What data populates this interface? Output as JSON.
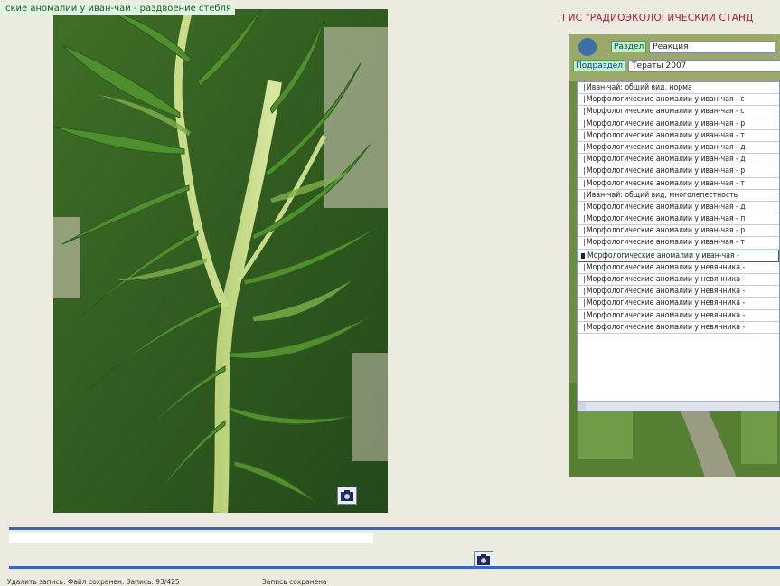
{
  "photo": {
    "caption": "ские аномалии у иван-чай - раздвоение стебля"
  },
  "gis": {
    "title": "ГИС \"РАДИОЭКОЛОГИЧЕСКИЙ СТАНД",
    "section_label": "Раздел",
    "section_value": "Реакция",
    "subsection_label": "Подраздел",
    "subsection_value": "Тераты 2007",
    "items": [
      "Иван-чай: общий вид, норма",
      "Морфологические аномалии у иван-чая - с",
      "Морфологические аномалии у иван-чая - с",
      "Морфологические аномалии у иван-чая - р",
      "Морфологические аномалии у иван-чая - т",
      "Морфологические аномалии у иван-чая - д",
      "Морфологические аномалии у иван-чая - д",
      "Морфологические аномалии у иван-чая - р",
      "Морфологические аномалии у иван-чая - т",
      "Иван-чай: общий вид, многолепестность",
      "Морфологические аномалии у иван-чая - д",
      "Морфологические аномалии у иван-чая - п",
      "Морфологические аномалии у иван-чая - р",
      "Морфологические аномалии у иван-чая - т",
      "Морфологические аномалии у иван-чая -",
      "Морфологические аномалии у невянника -",
      "Морфологические аномалии у невянника -",
      "Морфологические аномалии у невянника -",
      "Морфологические аномалии у невянника -",
      "Морфологические аномалии у невянника -",
      "Морфологические аномалии у невянника -"
    ],
    "selected_index": 14,
    "accent_title": "#a01c3a"
  },
  "status": {
    "left": "Удалить запись. Файл сохранен. Запись: 93/425",
    "right": "Запись сохранена"
  },
  "colors": {
    "rule": "#3b63c0",
    "background": "#ecebe0"
  }
}
